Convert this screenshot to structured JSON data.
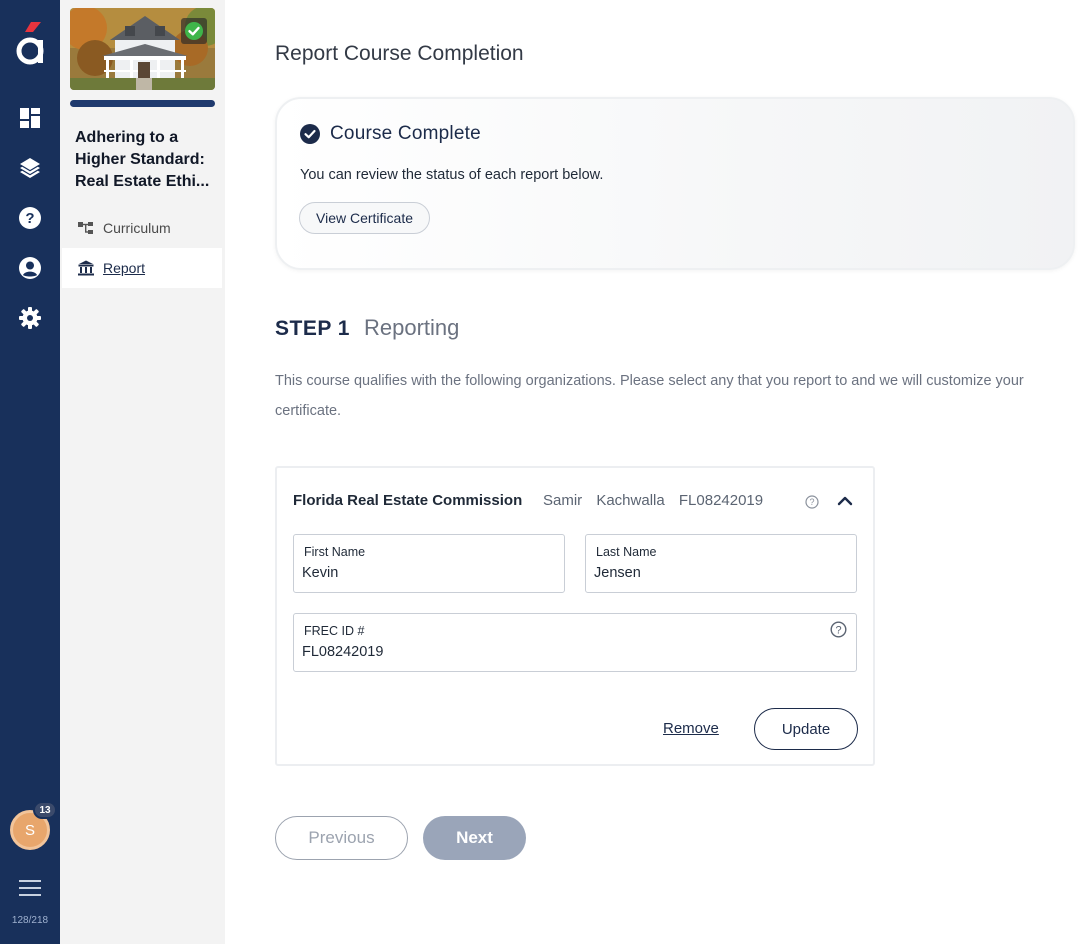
{
  "rail": {
    "icons": [
      "brand-logo-icon",
      "dashboard-icon",
      "layers-icon",
      "help-icon",
      "account-icon",
      "settings-icon",
      "menu-icon"
    ],
    "avatar_initial": "S",
    "notification_count": "13",
    "progress_count": "128/218",
    "colors": {
      "background": "#18305b",
      "logo_accent": "#e8343e"
    }
  },
  "course_panel": {
    "title_lines": [
      "Adhering to a",
      "Higher Standard:",
      "Real Estate Ethi..."
    ],
    "nav": [
      {
        "label": "Curriculum",
        "icon": "curriculum-tree-icon"
      },
      {
        "label": "Report",
        "icon": "institution-icon",
        "active": true
      }
    ]
  },
  "main": {
    "page_title": "Report Course Completion",
    "completion": {
      "heading": "Course Complete",
      "description": "You can review the status of each report below.",
      "certificate_button": "View Certificate"
    },
    "step": {
      "label": "STEP 1",
      "name": "Reporting",
      "description": "This course qualifies with the following organizations. Please select any that you report to and we will customize your certificate."
    },
    "organization": {
      "name": "Florida Real Estate Commission",
      "summary": "Samir Kachwalla FL08242019",
      "first_name_label": "First Name",
      "first_name_value": "Kevin",
      "last_name_label": "Last Name",
      "last_name_value": "Jensen",
      "id_label": "FREC ID #",
      "id_value": "FL08242019",
      "remove_label": "Remove",
      "update_label": "Update"
    },
    "nav_buttons": {
      "previous": "Previous",
      "next": "Next"
    },
    "colors": {
      "primary": "#1c2b4a",
      "next_disabled": "#9aa5b9",
      "check_green": "#3fb54a"
    }
  }
}
